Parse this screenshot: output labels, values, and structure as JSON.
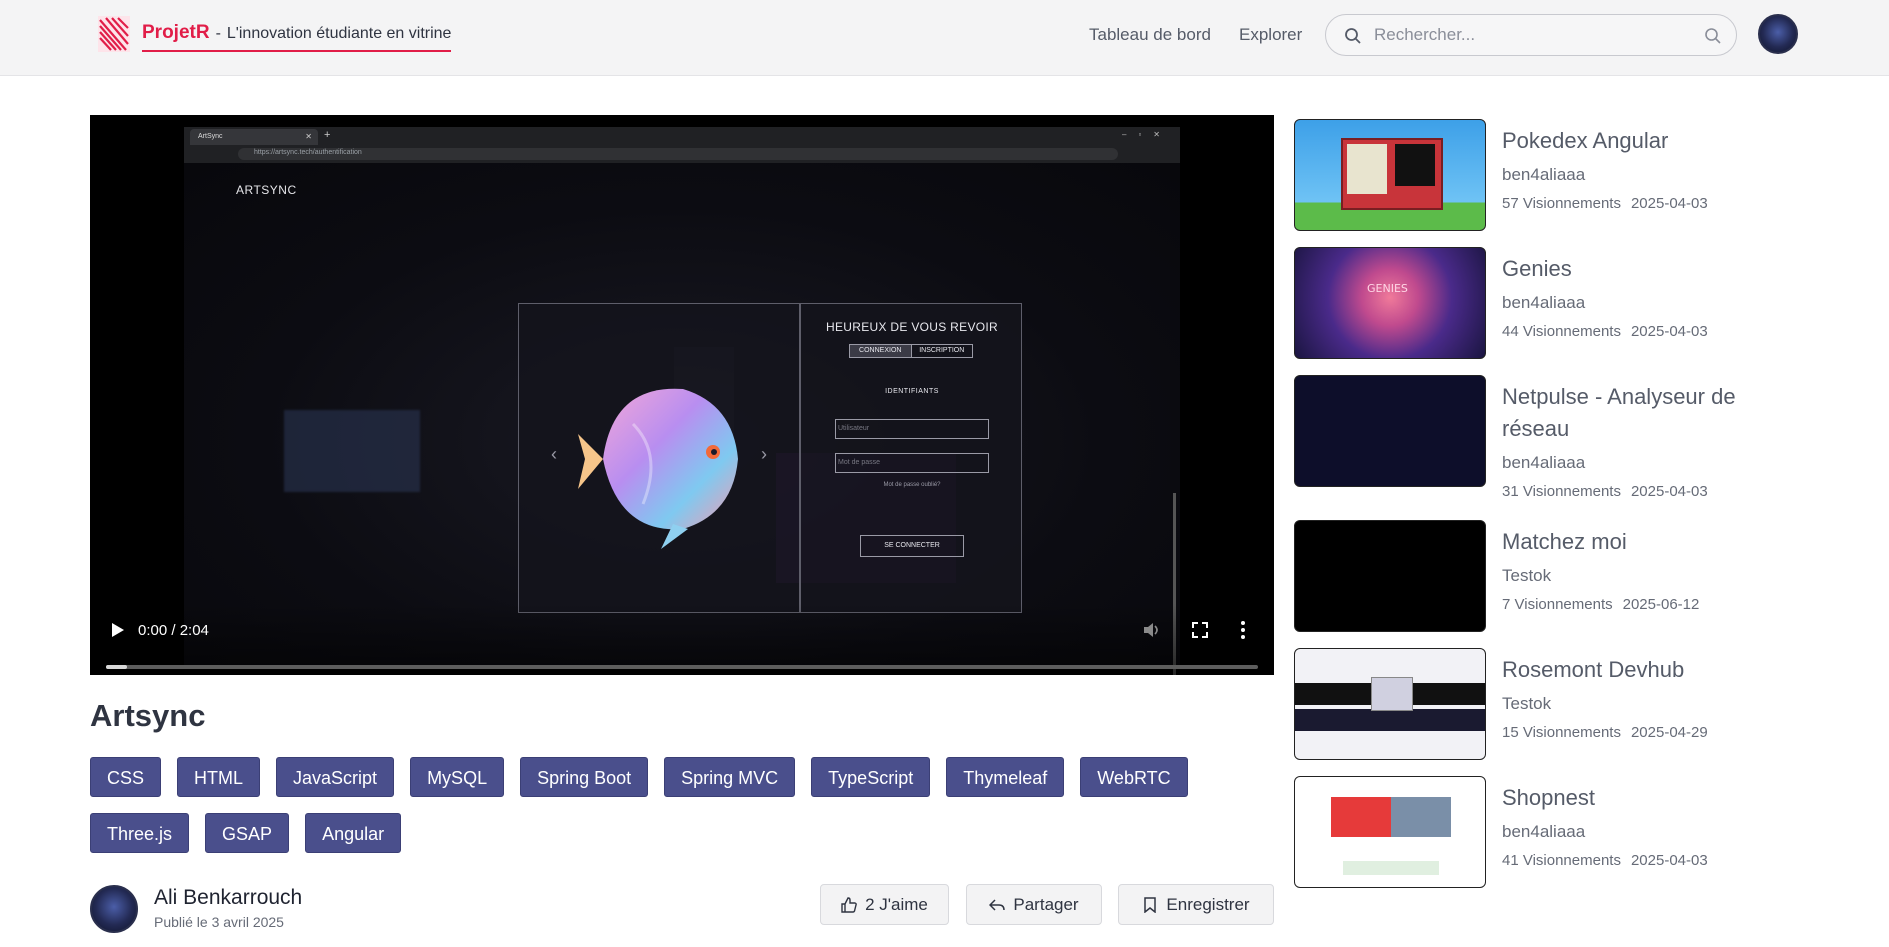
{
  "header": {
    "brand_name": "ProjetR",
    "brand_separator": "-",
    "brand_tagline": "L'innovation étudiante en vitrine",
    "nav": {
      "dashboard": "Tableau de bord",
      "explore": "Explorer"
    },
    "search": {
      "placeholder": "Rechercher..."
    }
  },
  "video": {
    "time": "0:00 / 2:04",
    "progress": 0.018,
    "frame": {
      "tab_title": "ArtSync",
      "url": "https://artsync.tech/authentification",
      "site_brand": "ARTSYNC",
      "card_title": "HEUREUX DE VOUS REVOIR",
      "tab_login": "CONNEXION",
      "tab_signup": "INSCRIPTION",
      "section_label": "IDENTIFIANTS",
      "user_placeholder": "Utilisateur",
      "password_placeholder": "Mot de passe",
      "forgot": "Mot de passe oublié?",
      "login_button": "SE CONNECTER"
    }
  },
  "title": "Artsync",
  "tags": [
    "CSS",
    "HTML",
    "JavaScript",
    "MySQL",
    "Spring Boot",
    "Spring MVC",
    "TypeScript",
    "Thymeleaf",
    "WebRTC",
    "Three.js",
    "GSAP",
    "Angular"
  ],
  "author": {
    "name": "Ali Benkarrouch",
    "published": "Publié le 3 avril 2025"
  },
  "actions": {
    "like": "2 J'aime",
    "share": "Partager",
    "save": "Enregistrer"
  },
  "related": [
    {
      "title": "Pokedex Angular",
      "author": "ben4aliaaa",
      "views": "57 Visionnements",
      "date": "2025-04-03"
    },
    {
      "title": "Genies",
      "author": "ben4aliaaa",
      "views": "44 Visionnements",
      "date": "2025-04-03"
    },
    {
      "title": "Netpulse - Analyseur de réseau",
      "author": "ben4aliaaa",
      "views": "31 Visionnements",
      "date": "2025-04-03"
    },
    {
      "title": "Matchez moi",
      "author": "Testok",
      "views": "7 Visionnements",
      "date": "2025-06-12"
    },
    {
      "title": "Rosemont Devhub",
      "author": "Testok",
      "views": "15 Visionnements",
      "date": "2025-04-29"
    },
    {
      "title": "Shopnest",
      "author": "ben4aliaaa",
      "views": "41 Visionnements",
      "date": "2025-04-03"
    }
  ],
  "colors": {
    "brand": "#e11d48",
    "tag_bg": "#4a4f8c",
    "text": "#2f3441"
  }
}
